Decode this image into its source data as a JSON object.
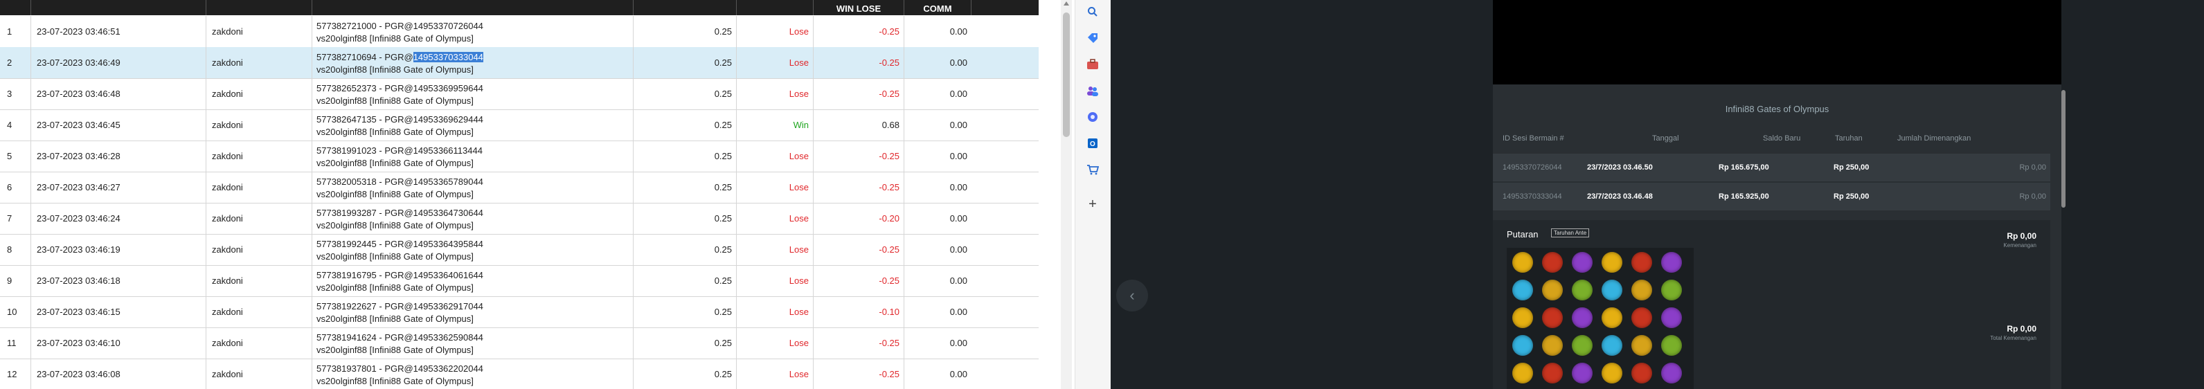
{
  "table": {
    "headers": {
      "win_lose": "WIN LOSE",
      "comm": "COMM"
    },
    "rows": [
      {
        "no": "1",
        "date": "23-07-2023 03:46:51",
        "user": "zakdoni",
        "desc1": "577382721000 - PGR@14953370726044",
        "desc2": "vs20olginf88 [Infini88 Gate of Olympus]",
        "amount": "0.25",
        "result": "Lose",
        "winlose": "-0.25",
        "comm": "0.00"
      },
      {
        "no": "2",
        "date": "23-07-2023 03:46:49",
        "user": "zakdoni",
        "desc1_pre": "577382710694 - PGR@",
        "desc1_hl": "14953370333044",
        "desc2": "vs20olginf88 [Infini88 Gate of Olympus]",
        "amount": "0.25",
        "result": "Lose",
        "winlose": "-0.25",
        "comm": "0.00"
      },
      {
        "no": "3",
        "date": "23-07-2023 03:46:48",
        "user": "zakdoni",
        "desc1": "577382652373 - PGR@14953369959644",
        "desc2": "vs20olginf88 [Infini88 Gate of Olympus]",
        "amount": "0.25",
        "result": "Lose",
        "winlose": "-0.25",
        "comm": "0.00"
      },
      {
        "no": "4",
        "date": "23-07-2023 03:46:45",
        "user": "zakdoni",
        "desc1": "577382647135 - PGR@14953369629444",
        "desc2": "vs20olginf88 [Infini88 Gate of Olympus]",
        "amount": "0.25",
        "result": "Win",
        "winlose": "0.68",
        "comm": "0.00"
      },
      {
        "no": "5",
        "date": "23-07-2023 03:46:28",
        "user": "zakdoni",
        "desc1": "577381991023 - PGR@14953366113444",
        "desc2": "vs20olginf88 [Infini88 Gate of Olympus]",
        "amount": "0.25",
        "result": "Lose",
        "winlose": "-0.25",
        "comm": "0.00"
      },
      {
        "no": "6",
        "date": "23-07-2023 03:46:27",
        "user": "zakdoni",
        "desc1": "577382005318 - PGR@14953365789044",
        "desc2": "vs20olginf88 [Infini88 Gate of Olympus]",
        "amount": "0.25",
        "result": "Lose",
        "winlose": "-0.25",
        "comm": "0.00"
      },
      {
        "no": "7",
        "date": "23-07-2023 03:46:24",
        "user": "zakdoni",
        "desc1": "577381993287 - PGR@14953364730644",
        "desc2": "vs20olginf88 [Infini88 Gate of Olympus]",
        "amount": "0.25",
        "result": "Lose",
        "winlose": "-0.20",
        "comm": "0.00"
      },
      {
        "no": "8",
        "date": "23-07-2023 03:46:19",
        "user": "zakdoni",
        "desc1": "577381992445 - PGR@14953364395844",
        "desc2": "vs20olginf88 [Infini88 Gate of Olympus]",
        "amount": "0.25",
        "result": "Lose",
        "winlose": "-0.25",
        "comm": "0.00"
      },
      {
        "no": "9",
        "date": "23-07-2023 03:46:18",
        "user": "zakdoni",
        "desc1": "577381916795 - PGR@14953364061644",
        "desc2": "vs20olginf88 [Infini88 Gate of Olympus]",
        "amount": "0.25",
        "result": "Lose",
        "winlose": "-0.25",
        "comm": "0.00"
      },
      {
        "no": "10",
        "date": "23-07-2023 03:46:15",
        "user": "zakdoni",
        "desc1": "577381922627 - PGR@14953362917044",
        "desc2": "vs20olginf88 [Infini88 Gate of Olympus]",
        "amount": "0.25",
        "result": "Lose",
        "winlose": "-0.10",
        "comm": "0.00"
      },
      {
        "no": "11",
        "date": "23-07-2023 03:46:10",
        "user": "zakdoni",
        "desc1": "577381941624 - PGR@14953362590844",
        "desc2": "vs20olginf88 [Infini88 Gate of Olympus]",
        "amount": "0.25",
        "result": "Lose",
        "winlose": "-0.25",
        "comm": "0.00"
      },
      {
        "no": "12",
        "date": "23-07-2023 03:46:08",
        "user": "zakdoni",
        "desc1": "577381937801 - PGR@14953362202044",
        "desc2": "vs20olginf88 [Infini88 Gate of Olympus]",
        "amount": "0.25",
        "result": "Lose",
        "winlose": "-0.25",
        "comm": "0.00"
      }
    ]
  },
  "edge_sidebar": {
    "icons": [
      "search-icon",
      "tag-icon",
      "briefcase-icon",
      "people-icon",
      "puzzle-icon",
      "outlook-icon",
      "cart-icon",
      "plus-icon"
    ]
  },
  "game_panel": {
    "title": "Infini88 Gates of Olympus",
    "headers": {
      "id": "ID Sesi Bermain #",
      "date": "Tanggal",
      "balance": "Saldo Baru",
      "bet": "Taruhan",
      "won": "Jumlah Dimenangkan"
    },
    "rows": [
      {
        "id": "14953370726044",
        "date": "23/7/2023 03.46.50",
        "balance": "Rp 165.675,00",
        "bet": "Rp 250,00",
        "won": "Rp 0,00"
      },
      {
        "id": "14953370333044",
        "date": "23/7/2023 03.46.48",
        "balance": "Rp 165.925,00",
        "bet": "Rp 250,00",
        "won": "Rp 0,00"
      }
    ],
    "round_label": "Putaran",
    "badge": "Taruhan Ante",
    "win_amount": "Rp 0,00",
    "win_sub": "Kemenangan",
    "total_amount": "Rp 0,00",
    "total_sub": "Total Kemenangan",
    "colors": {
      "accent_lose": "#e0262a",
      "accent_win": "#21a621"
    }
  }
}
